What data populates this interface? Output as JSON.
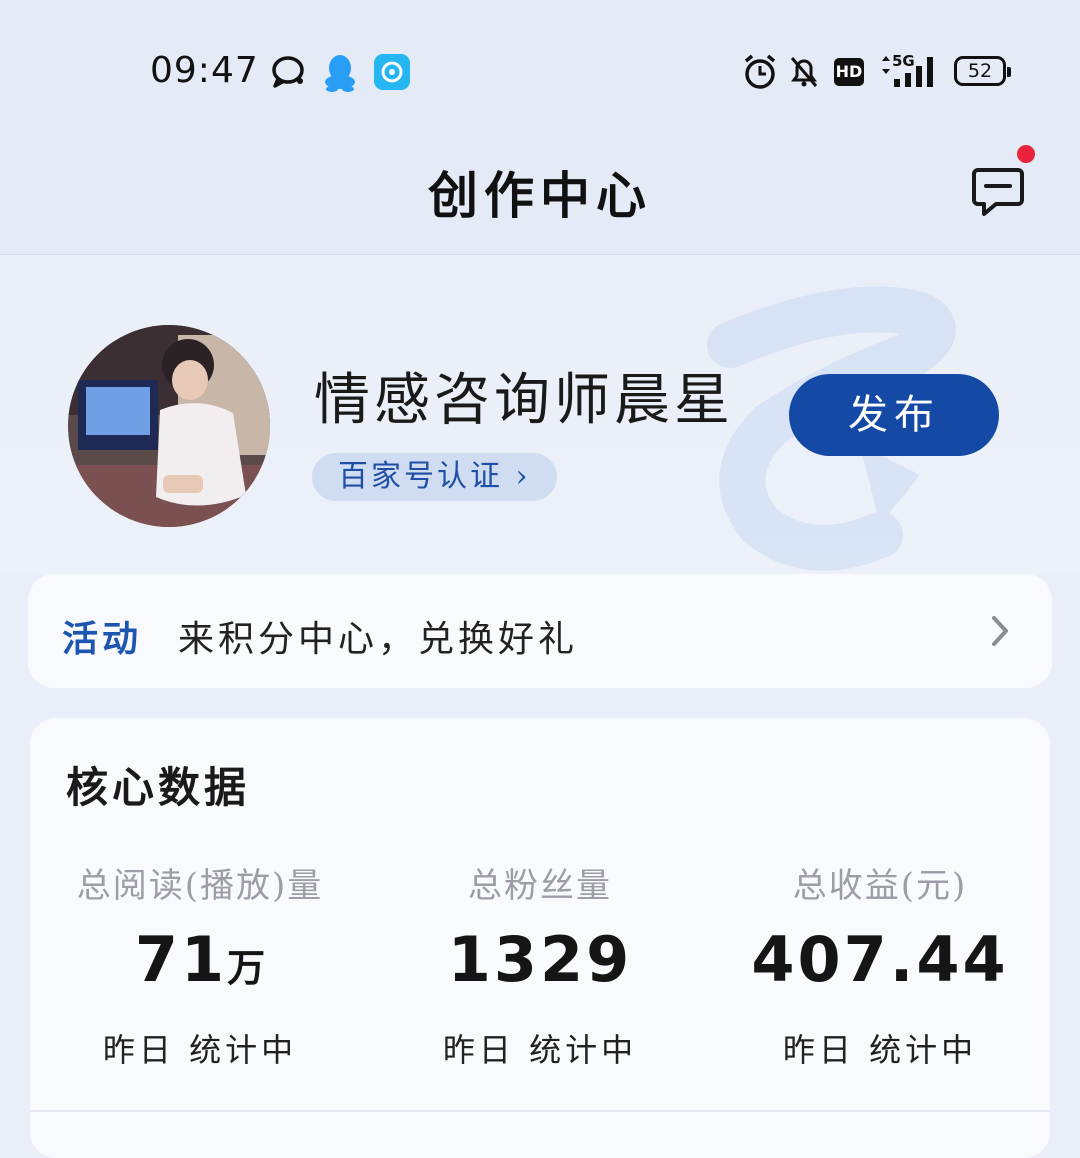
{
  "status_bar": {
    "time": "09:47",
    "network": "5G",
    "hd": "HD",
    "battery": "52",
    "icons": [
      "chat-bubble-icon",
      "qq-penguin-icon",
      "music-app-icon",
      "alarm-icon",
      "bell-muted-icon",
      "hd-icon",
      "signal-icon",
      "battery-icon"
    ]
  },
  "header": {
    "title": "创作中心",
    "message_icon": "message-icon"
  },
  "profile": {
    "name": "情感咨询师晨星",
    "cert_label": "百家号认证",
    "cert_arrow": "›",
    "publish_label": "发布"
  },
  "activity": {
    "tag": "活动",
    "text": "来积分中心，兑换好礼"
  },
  "core_data": {
    "title": "核心数据",
    "stats": [
      {
        "label": "总阅读(播放)量",
        "value": "71",
        "unit": "万",
        "sub": "昨日 统计中"
      },
      {
        "label": "总粉丝量",
        "value": "1329",
        "unit": "",
        "sub": "昨日 统计中"
      },
      {
        "label": "总收益(元)",
        "value": "407.44",
        "unit": "",
        "sub": "昨日 统计中"
      }
    ]
  },
  "colors": {
    "accent": "#1549a6",
    "notification": "#e8233b",
    "background": "#e9eef8"
  }
}
